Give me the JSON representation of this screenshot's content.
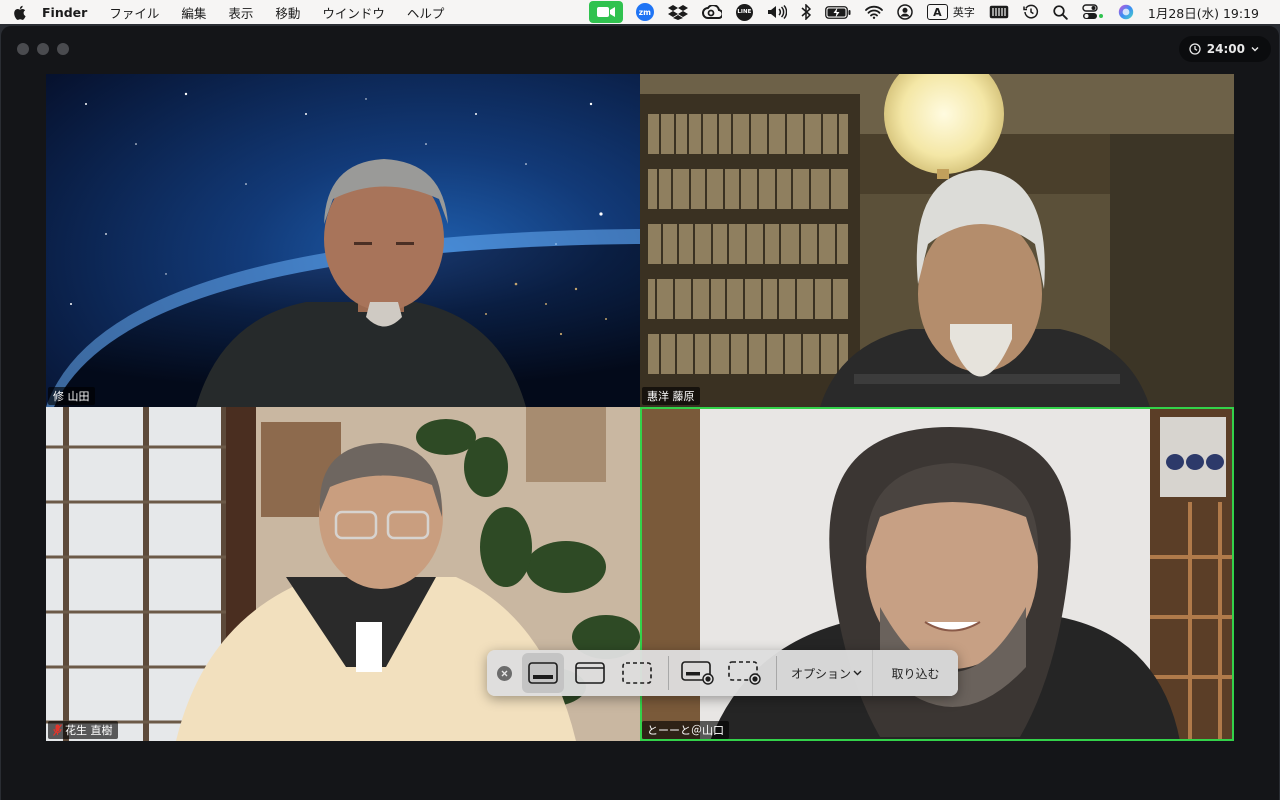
{
  "menubar": {
    "app_name": "Finder",
    "menus": [
      "ファイル",
      "編集",
      "表示",
      "移動",
      "ウインドウ",
      "ヘルプ"
    ],
    "zoom_badge": "zm",
    "line_badge": "LINE",
    "input_letter": "A",
    "input_label": "英字",
    "clock": "1月28日(水)  19:19"
  },
  "window": {
    "timer": "24:00"
  },
  "participants": [
    {
      "name": "修 山田",
      "muted": false
    },
    {
      "name": "惠洋 藤原",
      "muted": false
    },
    {
      "name": "花生 直樹",
      "muted": true
    },
    {
      "name": "とーーと＠山口",
      "muted": false,
      "active_speaker": true
    }
  ],
  "screenshot_toolbar": {
    "options_label": "オプション",
    "capture_label": "取り込む"
  },
  "colors": {
    "active_speaker_border": "#33d24a",
    "zoom_status_green": "#30c24f",
    "mute_red": "#e0352b"
  }
}
